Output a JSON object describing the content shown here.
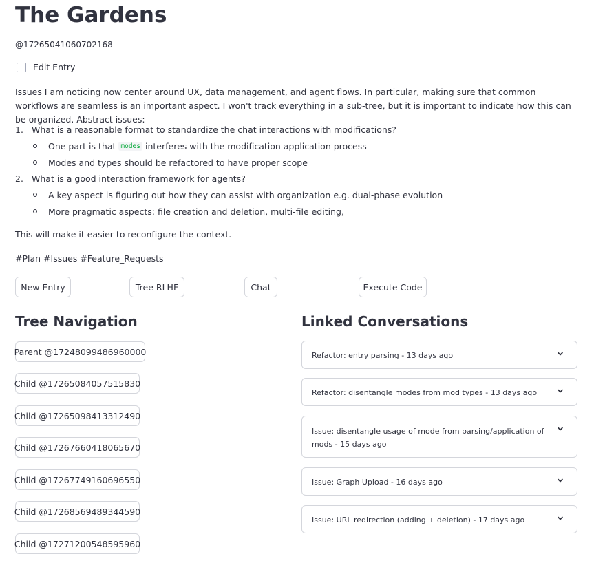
{
  "page": {
    "title": "The Gardens",
    "entry_id": "@17265041060702168"
  },
  "edit": {
    "label": "Edit Entry",
    "checked": false
  },
  "content": {
    "intro": "Issues I am noticing now center around UX, data management, and agent flows. In particular, making sure that common workflows are seamless is an important aspect. I won't track everything in a sub-tree, but it is important to indicate how this can be organized. Abstract issues:",
    "items": [
      {
        "num": "1.",
        "text": "What is a reasonable format to standardize the chat interactions with modifications?",
        "subs": [
          {
            "before": "One part is that",
            "code": "modes",
            "after": "interferes with the modification application process"
          },
          {
            "text": "Modes and types should be refactored to have proper scope"
          }
        ]
      },
      {
        "num": "2.",
        "text": "What is a good interaction framework for agents?",
        "subs": [
          {
            "text": "A key aspect is figuring out how they can assist with organization e.g. dual-phase evolution"
          },
          {
            "text": "More pragmatic aspects: file creation and deletion, multi-file editing,"
          }
        ]
      }
    ],
    "outro": "This will make it easier to reconfigure the context.",
    "tags": "#Plan #Issues #Feature_Requests"
  },
  "actions": {
    "new_entry": "New Entry",
    "tree_rlhf": "Tree RLHF",
    "chat": "Chat",
    "execute_code": "Execute Code"
  },
  "tree_nav": {
    "heading": "Tree Navigation",
    "parent": "Parent @17248099486960000",
    "children": [
      "Child @17265084057515830",
      "Child @17265098413312490",
      "Child @17267660418065670",
      "Child @17267749160696550",
      "Child @17268569489344590",
      "Child @17271200548595960"
    ]
  },
  "linked": {
    "heading": "Linked Conversations",
    "items": [
      "Refactor: entry parsing - 13 days ago",
      "Refactor: disentangle modes from mod types - 13 days ago",
      "Issue: disentangle usage of mode from parsing/application of mods - 15 days ago",
      "Issue: Graph Upload - 16 days ago",
      "Issue: URL redirection (adding + deletion) - 17 days ago"
    ]
  },
  "icons": {
    "expander": "chevron-down-icon"
  },
  "colors": {
    "text": "#31333f",
    "border": "#d4d6dc",
    "code": "#09ab3b"
  }
}
